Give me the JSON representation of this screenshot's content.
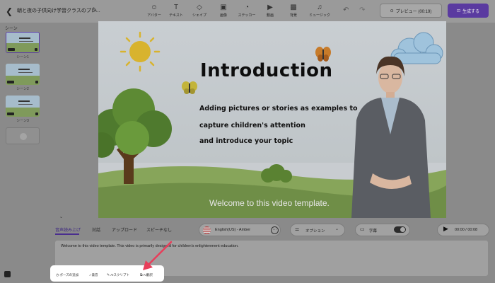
{
  "topbar": {
    "back_icon": "back-arrow-icon",
    "project_title": "朝と夜の子供向け学習クラスのプレ...",
    "tools": [
      {
        "icon": "avatar-icon",
        "glyph": "☺",
        "label": "アバター"
      },
      {
        "icon": "text-icon",
        "glyph": "T",
        "label": "テキスト"
      },
      {
        "icon": "shape-icon",
        "glyph": "◇",
        "label": "シェイプ"
      },
      {
        "icon": "image-icon",
        "glyph": "▣",
        "label": "画像"
      },
      {
        "icon": "sticker-icon",
        "glyph": "◔",
        "label": "ステッカー"
      },
      {
        "icon": "video-icon",
        "glyph": "▶",
        "label": "動画"
      },
      {
        "icon": "background-icon",
        "glyph": "▩",
        "label": "背景"
      },
      {
        "icon": "music-icon",
        "glyph": "♫",
        "label": "ミュージック"
      }
    ],
    "preview_label": "プレビュー (00:19)",
    "generate_label": "生成する"
  },
  "scenes": {
    "title": "シーン",
    "items": [
      {
        "name": "シーン1",
        "selected": true
      },
      {
        "name": "シーン2",
        "selected": false
      },
      {
        "name": "シーン3",
        "selected": false
      }
    ]
  },
  "canvas": {
    "headline": "Introduction",
    "lines": [
      "Adding pictures or stories as examples to",
      "capture children's attention",
      "and introduce your topic"
    ],
    "caption": "Welcome to this video template."
  },
  "script_panel": {
    "tabs": [
      "音声読み上げ",
      "対話",
      "アップロード",
      "スピーチなし"
    ],
    "active_tab": 0,
    "voice": "English(US) - Amber",
    "options_label": "オプション",
    "subtitle_label": "字幕",
    "subtitle_on": true,
    "time": "00:00 / 00:08",
    "script_text": "Welcome to this video template. This video is primarily designed for children's enlightenment education."
  },
  "popup": {
    "buttons": [
      {
        "icon": "clock-icon",
        "glyph": "◷",
        "label": "ポーズの追加"
      },
      {
        "icon": "music-note-icon",
        "glyph": "♪",
        "label": "発音"
      },
      {
        "icon": "ai-script-icon",
        "glyph": "✎",
        "label": "AIスクリプト"
      },
      {
        "icon": "translate-icon",
        "glyph": "⧉",
        "label": "AI翻訳"
      }
    ]
  },
  "colors": {
    "accent": "#5a3aa0",
    "arrow": "#e83e5a"
  }
}
